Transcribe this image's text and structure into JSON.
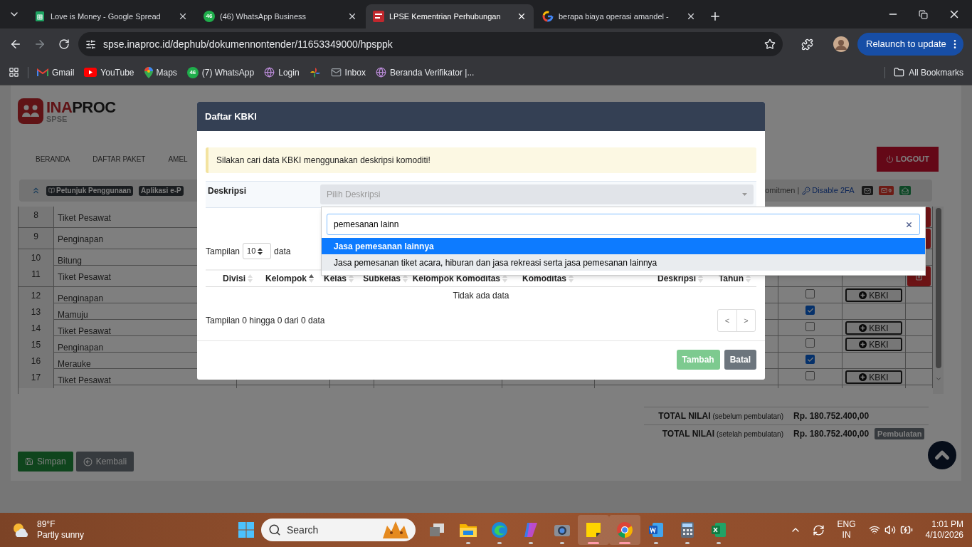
{
  "browser": {
    "tabs": [
      {
        "title": "Love is Money - Google Spread",
        "selected": false
      },
      {
        "title": "(46) WhatsApp Business",
        "badge": "46",
        "selected": false
      },
      {
        "title": "LPSE Kementrian Perhubungan",
        "selected": true
      },
      {
        "title": "berapa biaya operasi amandel -",
        "selected": false
      }
    ],
    "url": "spse.inaproc.id/dephub/dokumennontender/11653349000/hpsppk",
    "update_button": "Relaunch to update",
    "bookmarks": [
      {
        "label": "Gmail"
      },
      {
        "label": "YouTube"
      },
      {
        "label": "Maps"
      },
      {
        "label": "(7) WhatsApp",
        "badge": "46"
      },
      {
        "label": "Login"
      },
      {
        "label": "Inbox"
      },
      {
        "label": "Beranda Verifikator |..."
      }
    ],
    "all_bookmarks": "All Bookmarks"
  },
  "page": {
    "brand_a": "INA",
    "brand_b": "PROC",
    "brand_sub": "SPSE",
    "nav": [
      "BERANDA",
      "DAFTAR PAKET",
      "AMEL"
    ],
    "logout": "LOGOUT",
    "badges": [
      "Petunjuk Penggunaan",
      "Aplikasi e-P"
    ],
    "toolbar_text": "omitmen |",
    "toolbar_link": "Disable 2FA",
    "mail_count": "0",
    "rows": [
      {
        "no": "8",
        "item": "Tiket Pesawat",
        "deletable": true
      },
      {
        "no": "9",
        "item": "Penginapan",
        "deletable": true
      },
      {
        "no": "10",
        "item": "Bitung",
        "deletable": false
      },
      {
        "no": "11",
        "item": "Tiket Pesawat",
        "deletable": true
      },
      {
        "no": "12",
        "item": "Penginapan",
        "checked": false,
        "kbki_button": "KBKI",
        "deletable": false
      },
      {
        "no": "13",
        "item": "Mamuju",
        "checked": true,
        "deletable": false
      },
      {
        "no": "14",
        "item": "Tiket Pesawat",
        "checked": false,
        "kbki_button": "KBKI",
        "deletable": false
      },
      {
        "no": "15",
        "item": "Penginapan",
        "checked": false,
        "kbki_button": "KBKI",
        "deletable": false
      },
      {
        "no": "16",
        "item": "Merauke",
        "checked": true,
        "deletable": false
      },
      {
        "no": "17",
        "item": "Tiket Pesawat",
        "checked": false,
        "kbki_button": "KBKI",
        "deletable": false
      }
    ],
    "totals": [
      {
        "label": "TOTAL NILAI",
        "note": "(sebelum pembulatan)",
        "value": "Rp. 180.752.400,00"
      },
      {
        "label": "TOTAL NILAI",
        "note": "(setelah pembulatan)",
        "value": "Rp. 180.752.400,00",
        "badge": "Pembulatan"
      }
    ],
    "buttons": [
      {
        "label": "Simpan",
        "kind": "save"
      },
      {
        "label": "Kembali",
        "kind": "back"
      }
    ]
  },
  "modal": {
    "title": "Daftar KBKI",
    "alert": "Silakan cari data KBKI menggunakan deskripsi komoditi!",
    "field_label": "Deskripsi",
    "select_placeholder": "Pilih Deskripsi",
    "search_value": "pemesanan lainn",
    "options": [
      {
        "label": "Jasa pemesanan lainnya",
        "selected": true,
        "hovered": false
      },
      {
        "label": "Jasa pemesanan tiket acara, hiburan dan jasa rekreasi serta jasa pemesanan lainnya",
        "selected": false,
        "hovered": true
      }
    ],
    "length_label": "Tampilan",
    "length_value": "10",
    "length_suffix": "data",
    "columns": [
      {
        "label": "Divisi",
        "sorted": false
      },
      {
        "label": "Kelompok",
        "sorted": true
      },
      {
        "label": "Kelas",
        "sorted": false
      },
      {
        "label": "Subkelas",
        "sorted": false
      },
      {
        "label": "Kelompok Komoditas",
        "sorted": false
      },
      {
        "label": "Komoditas",
        "sorted": false
      },
      {
        "label": "Deskripsi",
        "sorted": false
      },
      {
        "label": "Tahun",
        "sorted": false
      }
    ],
    "empty": "Tidak ada data",
    "info": "Tampilan 0 hingga 0 dari 0 data",
    "pager": [
      "<",
      ">"
    ],
    "buttons": [
      {
        "label": "Tambah",
        "kind": "primary",
        "disabled": true
      },
      {
        "label": "Batal",
        "kind": "secondary",
        "disabled": false
      }
    ]
  },
  "taskbar": {
    "temp": "89°F",
    "weather": "Partly sunny",
    "search": "Search",
    "apps": [
      {
        "running": false,
        "active": false
      },
      {
        "running": true,
        "active": false
      },
      {
        "running": true,
        "active": false
      },
      {
        "running": true,
        "active": false
      },
      {
        "running": true,
        "active": false
      },
      {
        "running": true,
        "active": true
      },
      {
        "running": true,
        "active": true
      },
      {
        "running": true,
        "active": false
      },
      {
        "running": true,
        "active": false
      },
      {
        "running": true,
        "active": false
      }
    ],
    "lang": "ENG",
    "region": "IN",
    "time": "1:01 PM",
    "date": "4/10/2026"
  }
}
